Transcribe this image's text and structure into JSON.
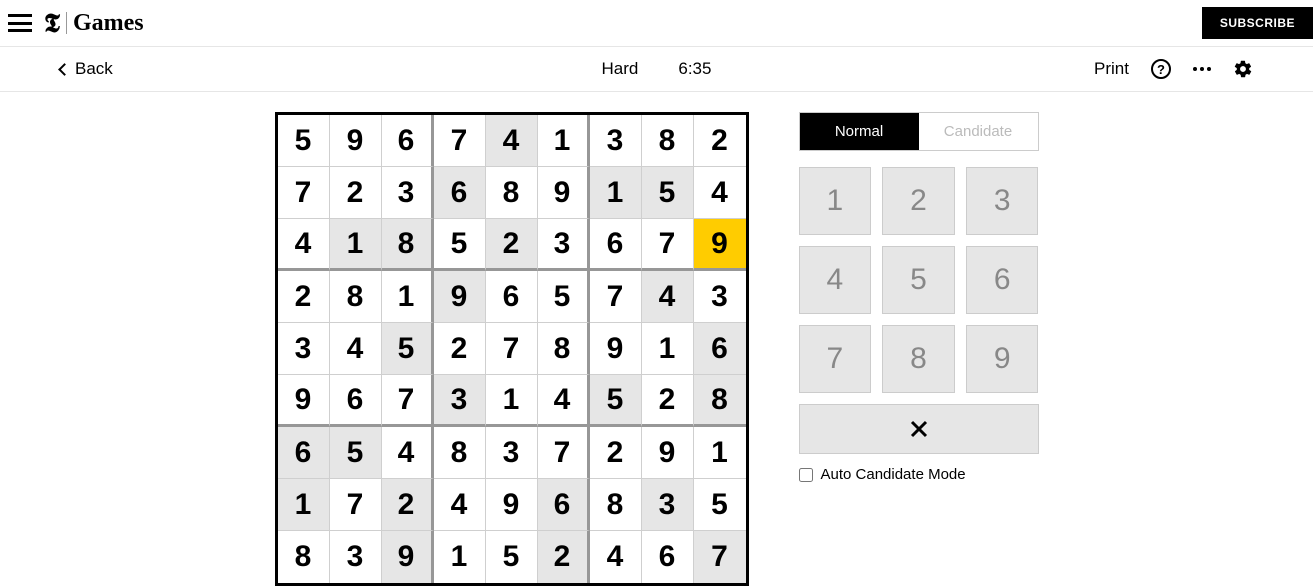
{
  "header": {
    "logo_brand": "Games",
    "subscribe": "SUBSCRIBE"
  },
  "subbar": {
    "back": "Back",
    "difficulty": "Hard",
    "timer": "6:35",
    "print": "Print"
  },
  "board": {
    "cells": [
      {
        "v": "5",
        "p": false
      },
      {
        "v": "9",
        "p": false
      },
      {
        "v": "6",
        "p": false
      },
      {
        "v": "7",
        "p": false
      },
      {
        "v": "4",
        "p": true
      },
      {
        "v": "1",
        "p": false
      },
      {
        "v": "3",
        "p": false
      },
      {
        "v": "8",
        "p": false
      },
      {
        "v": "2",
        "p": false
      },
      {
        "v": "7",
        "p": false
      },
      {
        "v": "2",
        "p": false
      },
      {
        "v": "3",
        "p": false
      },
      {
        "v": "6",
        "p": true
      },
      {
        "v": "8",
        "p": false
      },
      {
        "v": "9",
        "p": false
      },
      {
        "v": "1",
        "p": true
      },
      {
        "v": "5",
        "p": true
      },
      {
        "v": "4",
        "p": false
      },
      {
        "v": "4",
        "p": false
      },
      {
        "v": "1",
        "p": true
      },
      {
        "v": "8",
        "p": true
      },
      {
        "v": "5",
        "p": false
      },
      {
        "v": "2",
        "p": true
      },
      {
        "v": "3",
        "p": false
      },
      {
        "v": "6",
        "p": false
      },
      {
        "v": "7",
        "p": false
      },
      {
        "v": "9",
        "p": false,
        "sel": true
      },
      {
        "v": "2",
        "p": false
      },
      {
        "v": "8",
        "p": false
      },
      {
        "v": "1",
        "p": false
      },
      {
        "v": "9",
        "p": true
      },
      {
        "v": "6",
        "p": false
      },
      {
        "v": "5",
        "p": false
      },
      {
        "v": "7",
        "p": false
      },
      {
        "v": "4",
        "p": true
      },
      {
        "v": "3",
        "p": false
      },
      {
        "v": "3",
        "p": false
      },
      {
        "v": "4",
        "p": false
      },
      {
        "v": "5",
        "p": true
      },
      {
        "v": "2",
        "p": false
      },
      {
        "v": "7",
        "p": false
      },
      {
        "v": "8",
        "p": false
      },
      {
        "v": "9",
        "p": false
      },
      {
        "v": "1",
        "p": false
      },
      {
        "v": "6",
        "p": true
      },
      {
        "v": "9",
        "p": false
      },
      {
        "v": "6",
        "p": false
      },
      {
        "v": "7",
        "p": false
      },
      {
        "v": "3",
        "p": true
      },
      {
        "v": "1",
        "p": false
      },
      {
        "v": "4",
        "p": false
      },
      {
        "v": "5",
        "p": true
      },
      {
        "v": "2",
        "p": false
      },
      {
        "v": "8",
        "p": true
      },
      {
        "v": "6",
        "p": true
      },
      {
        "v": "5",
        "p": true
      },
      {
        "v": "4",
        "p": false
      },
      {
        "v": "8",
        "p": false
      },
      {
        "v": "3",
        "p": false
      },
      {
        "v": "7",
        "p": false
      },
      {
        "v": "2",
        "p": false
      },
      {
        "v": "9",
        "p": false
      },
      {
        "v": "1",
        "p": false
      },
      {
        "v": "1",
        "p": true
      },
      {
        "v": "7",
        "p": false
      },
      {
        "v": "2",
        "p": true
      },
      {
        "v": "4",
        "p": false
      },
      {
        "v": "9",
        "p": false
      },
      {
        "v": "6",
        "p": true
      },
      {
        "v": "8",
        "p": false
      },
      {
        "v": "3",
        "p": true
      },
      {
        "v": "5",
        "p": false
      },
      {
        "v": "8",
        "p": false
      },
      {
        "v": "3",
        "p": false
      },
      {
        "v": "9",
        "p": true
      },
      {
        "v": "1",
        "p": false
      },
      {
        "v": "5",
        "p": false
      },
      {
        "v": "2",
        "p": true
      },
      {
        "v": "4",
        "p": false
      },
      {
        "v": "6",
        "p": false
      },
      {
        "v": "7",
        "p": true
      }
    ]
  },
  "controls": {
    "mode_normal": "Normal",
    "mode_candidate": "Candidate",
    "numpad": [
      "1",
      "2",
      "3",
      "4",
      "5",
      "6",
      "7",
      "8",
      "9"
    ],
    "auto_candidate": "Auto Candidate Mode"
  }
}
